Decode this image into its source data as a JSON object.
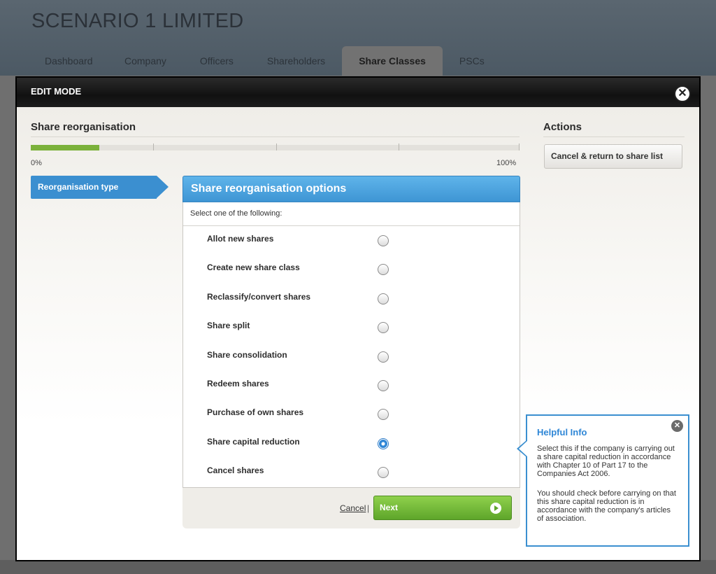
{
  "app": {
    "company_name": "SCENARIO 1 LIMITED",
    "tabs": [
      {
        "label": "Dashboard"
      },
      {
        "label": "Company"
      },
      {
        "label": "Officers"
      },
      {
        "label": "Shareholders"
      },
      {
        "label": "Share Classes"
      },
      {
        "label": "PSCs"
      }
    ],
    "active_tab": "Share Classes"
  },
  "modal": {
    "title": "EDIT MODE",
    "close_icon": "close-icon"
  },
  "section": {
    "title": "Share reorganisation",
    "progress": {
      "fraction": 0.14,
      "start_label": "0%",
      "end_label": "100%"
    }
  },
  "steps": [
    {
      "label": "Reorganisation type",
      "active": true
    }
  ],
  "options_panel": {
    "title": "Share reorganisation options",
    "instruction": "Select one of the following:",
    "options": [
      {
        "label": "Allot new shares",
        "selected": false
      },
      {
        "label": "Create new share class",
        "selected": false
      },
      {
        "label": "Reclassify/convert shares",
        "selected": false
      },
      {
        "label": "Share split",
        "selected": false
      },
      {
        "label": "Share consolidation",
        "selected": false
      },
      {
        "label": "Redeem shares",
        "selected": false
      },
      {
        "label": "Purchase of own shares",
        "selected": false
      },
      {
        "label": "Share capital reduction",
        "selected": true
      },
      {
        "label": "Cancel shares",
        "selected": false
      }
    ],
    "cancel_label": "Cancel",
    "separator": "|",
    "next_label": "Next"
  },
  "actions": {
    "title": "Actions",
    "cancel_return_label": "Cancel & return to share list"
  },
  "helpful_info": {
    "title": "Helpful Info",
    "paragraph_1": "Select this if the company is carrying out a share capital reduction in accordance with Chapter 10 of Part 17 to the Companies Act 2006.",
    "paragraph_2": "You should check before carrying on that this share capital reduction is in accordance with the company's articles of association."
  },
  "colors": {
    "accent_blue": "#3b8fd0",
    "next_green": "#6cb432",
    "progress_green": "#7bb13b"
  }
}
